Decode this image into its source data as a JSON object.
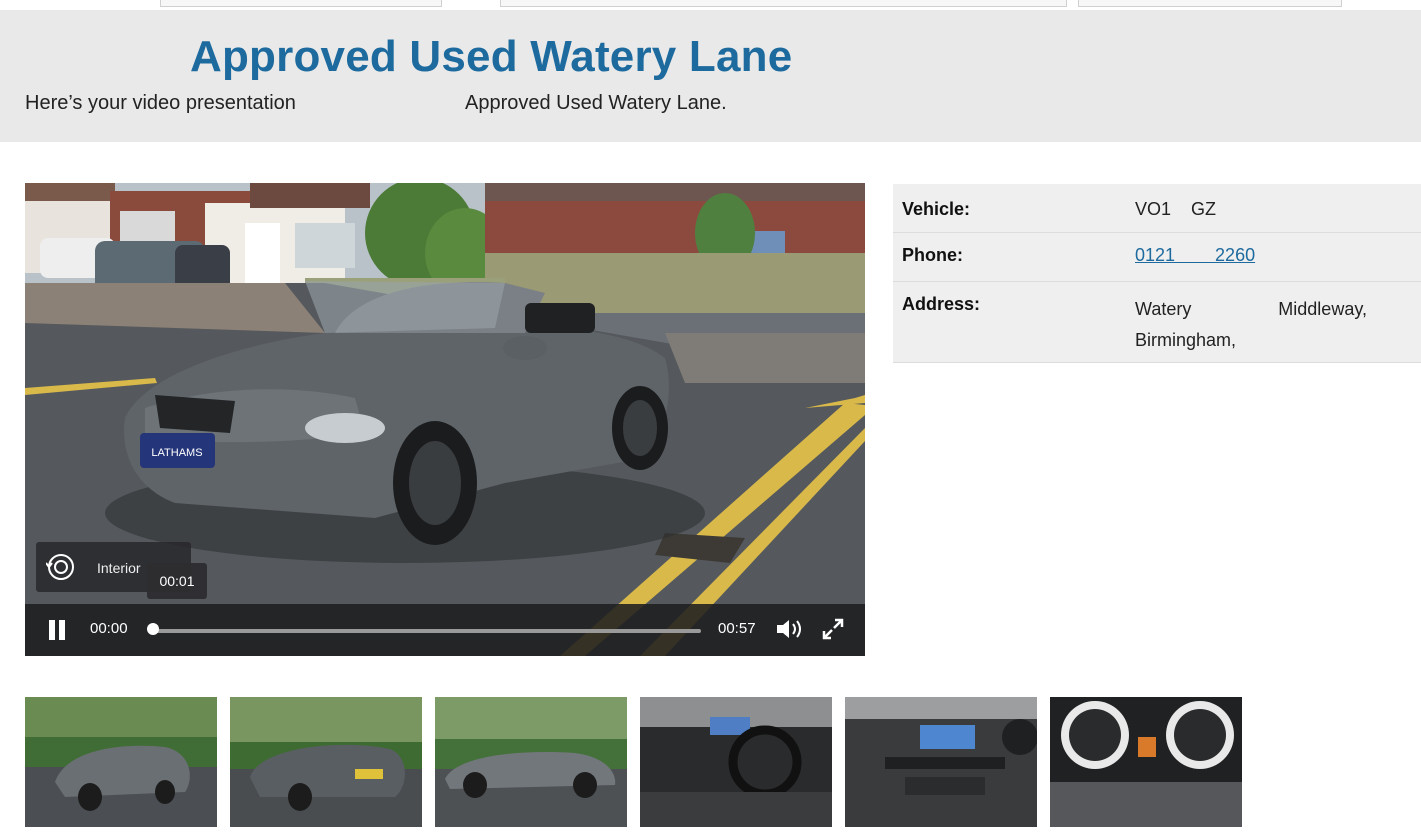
{
  "header": {
    "title": "Approved Used Watery Lane",
    "subtitle_left": "Here’s your video presentation",
    "subtitle_right": "Approved Used Watery Lane."
  },
  "video": {
    "current_time": "00:00",
    "total_time": "00:57",
    "hover_time": "00:01",
    "interior_label": "Interior",
    "progress": 0.0,
    "plate_text": "LATHAMS"
  },
  "info": {
    "vehicle_label": "Vehicle:",
    "vehicle_value": "VO1    GZ",
    "phone_label": "Phone:",
    "phone_value": "0121        2260",
    "address_label": "Address:",
    "address_line1_a": "Watery",
    "address_line1_b": "Middleway,",
    "address_line2": "Birmingham,"
  },
  "thumbnails": [
    {
      "view": "front-exterior"
    },
    {
      "view": "rear-exterior"
    },
    {
      "view": "side-exterior"
    },
    {
      "view": "dashboard-interior"
    },
    {
      "view": "center-console-interior"
    },
    {
      "view": "instrument-cluster"
    }
  ],
  "colors": {
    "title_blue": "#1d6a9e",
    "banner_bg": "#e9e9e9",
    "car_grey": "#5f6468"
  }
}
